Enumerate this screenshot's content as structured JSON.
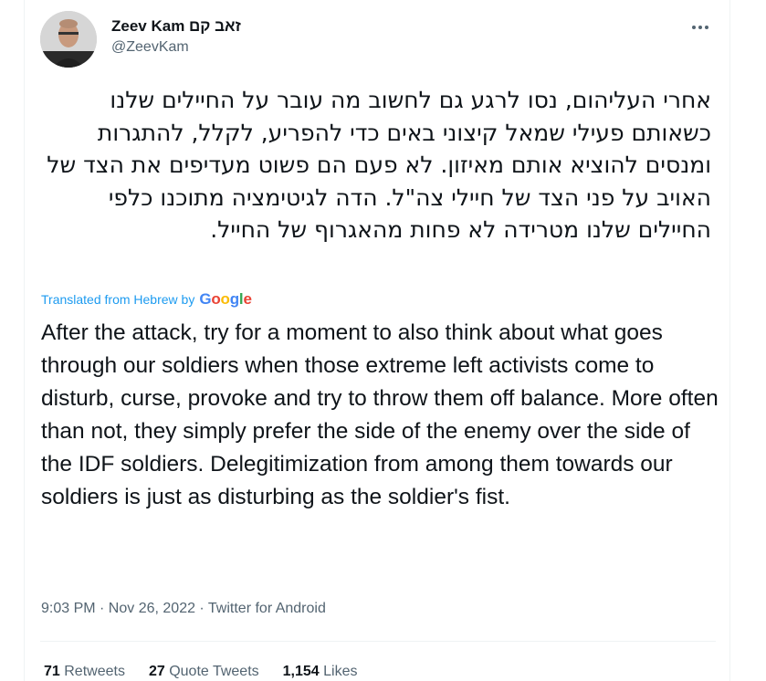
{
  "tweet": {
    "author": {
      "display_name": "Zeev Kam זאב קם",
      "handle": "@ZeevKam",
      "avatar_icon": "profile-photo"
    },
    "original_text": "אחרי העליהום, נסו לרגע גם לחשוב מה עובר על החיילים שלנו כשאותם פעילי שמאל קיצוני באים כדי להפריע, לקלל, להתגרות ומנסים להוציא אותם מאיזון. לא פעם הם פשוט מעדיפים את הצד של האויב על פני הצד של חיילי צה\"ל. הדה לגיטימציה מתוכנו כלפי החיילים שלנו מטרידה לא פחות מהאגרוף של החייל.",
    "translated_label": "Translated from Hebrew by",
    "translation_provider": "Google",
    "translated_text": "After the attack, try for a moment to also think about what goes through our soldiers when those extreme left activists come to disturb, curse, provoke and try to throw them off balance. More often than not, they simply prefer the side of the enemy over the side of the IDF soldiers. Delegitimization from among them towards our soldiers is just as disturbing as the soldier's fist.",
    "meta": "9:03 PM · Nov 26, 2022 · Twitter for Android",
    "stats": {
      "retweets_count": "71",
      "retweets_label": "Retweets",
      "quotes_count": "27",
      "quotes_label": "Quote Tweets",
      "likes_count": "1,154",
      "likes_label": "Likes"
    }
  },
  "colors": {
    "text": "#0f1419",
    "secondary": "#536471",
    "link": "#1d9bf0",
    "border": "#eff3f4"
  }
}
